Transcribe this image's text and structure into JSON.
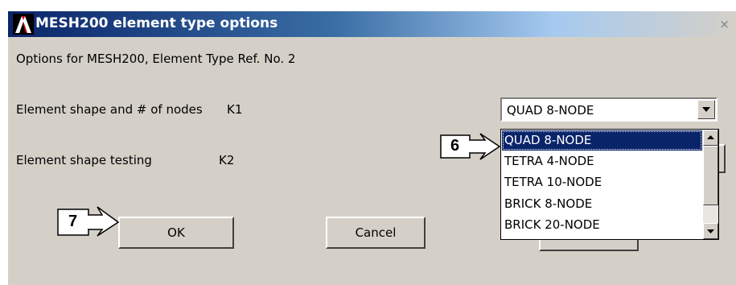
{
  "window": {
    "title": "MESH200 element type options",
    "close_symbol": "×"
  },
  "dialog": {
    "header_text": "Options for MESH200, Element Type Ref. No. 2",
    "shape_label": "Element shape and # of nodes",
    "shape_key": "K1",
    "testing_label": "Element shape testing",
    "testing_key": "K2"
  },
  "shape_select": {
    "value": "QUAD  8-NODE",
    "options": [
      "QUAD  8-NODE",
      "TETRA  4-NODE",
      "TETRA 10-NODE",
      "BRICK  8-NODE",
      "BRICK 20-NODE"
    ],
    "selected_index": 0
  },
  "buttons": {
    "ok": "OK",
    "cancel": "Cancel"
  },
  "callouts": {
    "six": "6",
    "seven": "7"
  },
  "icons": {
    "app_logo": "ansys-logo-icon",
    "close": "close-icon",
    "dropdown": "chevron-down-icon",
    "scroll_up": "scroll-up-arrow-icon",
    "scroll_down": "scroll-down-arrow-icon"
  },
  "colors": {
    "dialog_bg": "#d4d0c8",
    "titlebar_start": "#0a246a",
    "selection": "#0a246a"
  }
}
